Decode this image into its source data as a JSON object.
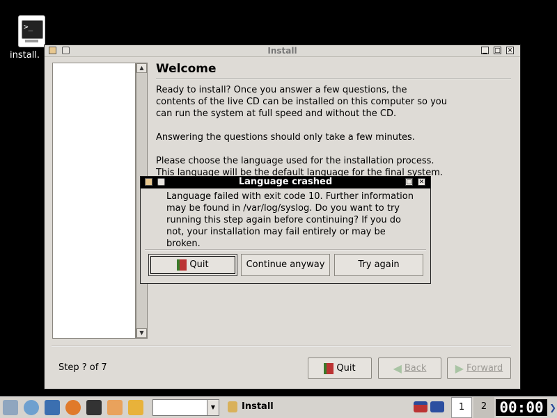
{
  "desktop": {
    "icon_label": "install.",
    "icon_glyph": ">_"
  },
  "main_window": {
    "title": "Install",
    "heading": "Welcome",
    "paragraphs": [
      "Ready to install? Once you answer a few questions, the contents of the live CD can be installed on this computer so you can run the system at full speed and without the CD.",
      "Answering the questions should only take a few minutes.",
      "Please choose the language used for the installation process. This language will be the default language for the final system."
    ],
    "step_label": "Step ? of 7",
    "buttons": {
      "quit": "Quit",
      "back": "Back",
      "forward": "Forward"
    }
  },
  "dialog": {
    "title": "Language crashed",
    "message": "Language failed with exit code 10. Further information may be found in /var/log/syslog. Do you want to try running this step again before continuing? If you do not, your installation may fail entirely or may be broken.",
    "buttons": {
      "quit": "Quit",
      "continue": "Continue anyway",
      "retry": "Try again"
    }
  },
  "taskbar": {
    "task_label": "Install",
    "workspaces": [
      "1",
      "2"
    ],
    "clock": "00:00",
    "colors": {
      "bar": "#d6d3ce",
      "clock_bg": "#000000"
    }
  }
}
